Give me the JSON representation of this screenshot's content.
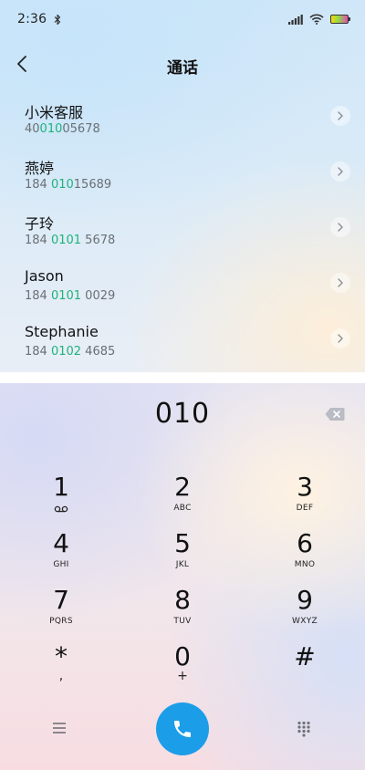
{
  "status_bar": {
    "time": "2:36",
    "icons": [
      "bluetooth-icon",
      "signal-icon",
      "wifi-icon",
      "battery-icon"
    ]
  },
  "header": {
    "title": "通话",
    "back_icon": "back-arrow-icon"
  },
  "contacts": [
    {
      "name": "小米客服",
      "number_prefix": "40",
      "number_match": "010",
      "number_suffix": "05678"
    },
    {
      "name": "燕婷",
      "number_prefix": "184 ",
      "number_match": "010",
      "number_suffix": "15689"
    },
    {
      "name": "子玲",
      "number_prefix": "184 ",
      "number_match": "0101",
      "number_suffix": " 5678"
    },
    {
      "name": "Jason",
      "number_prefix": "184 ",
      "number_match": "0101",
      "number_suffix": " 0029"
    },
    {
      "name": "Stephanie",
      "number_prefix": "184 ",
      "number_match": "0102",
      "number_suffix": " 4685"
    }
  ],
  "dialer": {
    "input_value": "010",
    "keys": [
      {
        "digit": "1",
        "letters": ""
      },
      {
        "digit": "2",
        "letters": "ABC"
      },
      {
        "digit": "3",
        "letters": "DEF"
      },
      {
        "digit": "4",
        "letters": "GHI"
      },
      {
        "digit": "5",
        "letters": "JKL"
      },
      {
        "digit": "6",
        "letters": "MNO"
      },
      {
        "digit": "7",
        "letters": "PQRS"
      },
      {
        "digit": "8",
        "letters": "TUV"
      },
      {
        "digit": "9",
        "letters": "WXYZ"
      },
      {
        "digit": "*",
        "letters": ","
      },
      {
        "digit": "0",
        "letters": "+"
      },
      {
        "digit": "#",
        "letters": ""
      }
    ]
  },
  "colors": {
    "accent": "#1c9de8",
    "match_highlight": "#1fb27a"
  }
}
